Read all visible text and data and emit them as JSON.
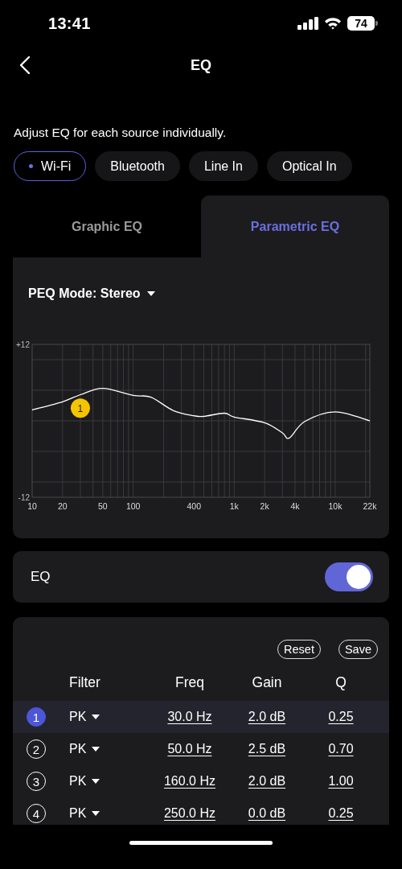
{
  "status_bar": {
    "time": "13:41",
    "battery": "74"
  },
  "header": {
    "title": "EQ"
  },
  "description": "Adjust EQ for each source individually.",
  "sources": [
    {
      "label": "Wi-Fi",
      "selected": true
    },
    {
      "label": "Bluetooth",
      "selected": false
    },
    {
      "label": "Line In",
      "selected": false
    },
    {
      "label": "Optical In",
      "selected": false
    }
  ],
  "tabs": [
    {
      "label": "Graphic EQ",
      "selected": false
    },
    {
      "label": "Parametric EQ",
      "selected": true
    }
  ],
  "peq_mode": {
    "label": "PEQ Mode: Stereo"
  },
  "eq_graph": {
    "y_labels": [
      "+12",
      "-12"
    ],
    "x_labels": [
      "10",
      "20",
      "50",
      "100",
      "400",
      "1k",
      "2k",
      "4k",
      "10k",
      "22k"
    ],
    "marker": "1"
  },
  "eq_switch": {
    "label": "EQ",
    "on": true
  },
  "actions": [
    "Reset",
    "Save"
  ],
  "columns": [
    "Filter",
    "Freq",
    "Gain",
    "Q"
  ],
  "filters": [
    {
      "number": "1",
      "selected": true,
      "type": "PK",
      "freq": "30.0 Hz",
      "gain": "2.0 dB",
      "q": "0.25"
    },
    {
      "number": "2",
      "selected": false,
      "type": "PK",
      "freq": "50.0 Hz",
      "gain": "2.5 dB",
      "q": "0.70"
    },
    {
      "number": "3",
      "selected": false,
      "type": "PK",
      "freq": "160.0 Hz",
      "gain": "2.0 dB",
      "q": "1.00"
    },
    {
      "number": "4",
      "selected": false,
      "type": "PK",
      "freq": "250.0 Hz",
      "gain": "0.0 dB",
      "q": "0.25"
    }
  ]
}
